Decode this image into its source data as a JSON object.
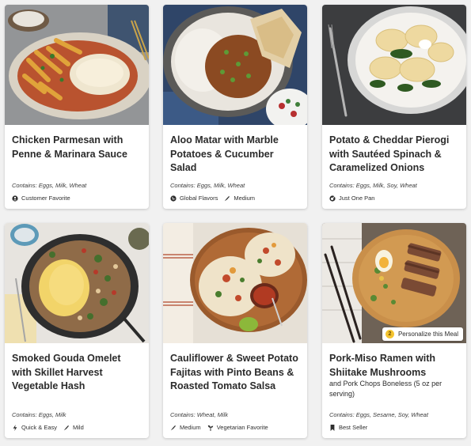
{
  "cards": [
    {
      "title": "Chicken Parmesan with Penne & Marinara Sauce",
      "subtitle": "",
      "contains": "Contains: Eggs, Milk, Wheat",
      "tags": [
        {
          "label": "Customer Favorite",
          "icon": "person-icon"
        }
      ]
    },
    {
      "title": "Aloo Matar with Marble Potatoes & Cucumber Salad",
      "subtitle": "",
      "contains": "Contains: Eggs, Milk, Wheat",
      "tags": [
        {
          "label": "Global Flavors",
          "icon": "globe-icon"
        },
        {
          "label": "Medium",
          "icon": "chili-icon"
        }
      ]
    },
    {
      "title": "Potato & Cheddar Pierogi with Sautéed Spinach & Caramelized Onions",
      "subtitle": "",
      "contains": "Contains: Eggs, Milk, Soy, Wheat",
      "tags": [
        {
          "label": "Just One Pan",
          "icon": "pan-icon"
        }
      ]
    },
    {
      "title": "Smoked Gouda Omelet with Skillet Harvest Vegetable Hash",
      "subtitle": "",
      "contains": "Contains: Eggs, Milk",
      "tags": [
        {
          "label": "Quick & Easy",
          "icon": "lightning-icon"
        },
        {
          "label": "Mild",
          "icon": "chili-icon"
        }
      ]
    },
    {
      "title": "Cauliflower & Sweet Potato Fajitas with Pinto Beans & Roasted Tomato Salsa",
      "subtitle": "",
      "contains": "Contains: Wheat, Milk",
      "tags": [
        {
          "label": "Medium",
          "icon": "chili-icon"
        },
        {
          "label": "Vegetarian Favorite",
          "icon": "sprout-icon"
        }
      ]
    },
    {
      "title": "Pork-Miso Ramen with Shiitake Mushrooms",
      "subtitle": "and Pork Chops Boneless (5 oz per serving)",
      "contains": "Contains: Eggs, Sesame, Soy, Wheat",
      "tags": [
        {
          "label": "Best Seller",
          "icon": "bookmark-icon"
        }
      ],
      "personalize": {
        "number": "2",
        "label": "Personalize this Meal"
      }
    }
  ]
}
